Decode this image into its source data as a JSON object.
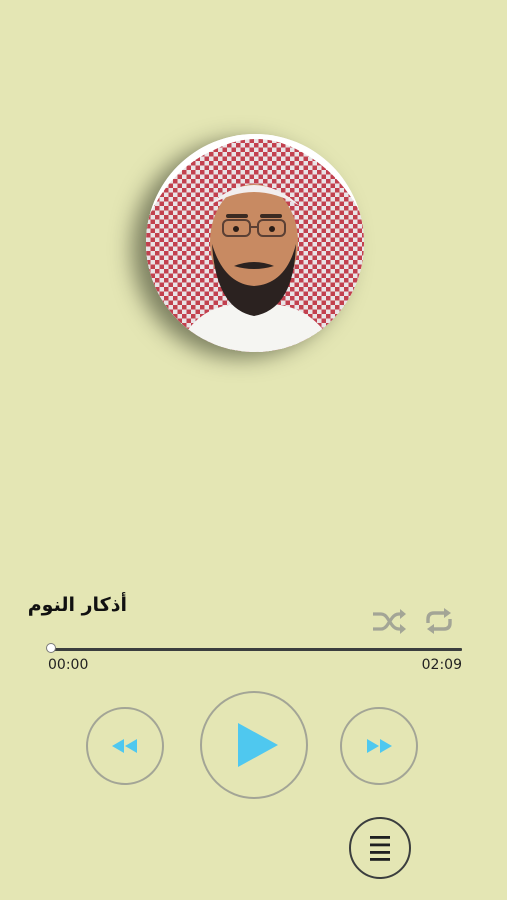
{
  "track": {
    "title": "أذكار النوم"
  },
  "player": {
    "elapsed": "00:00",
    "total": "02:09",
    "progress_fraction": 0.0
  },
  "icons": {
    "shuffle": "shuffle-icon",
    "repeat": "repeat-icon",
    "previous": "rewind-icon",
    "play": "play-icon",
    "next": "fast-forward-icon",
    "playlist": "list-icon"
  },
  "colors": {
    "background": "#e4e6b4",
    "accent": "#4fc8ef",
    "inactive_icon": "#a3a596",
    "seek_track": "#3b3e3e"
  }
}
